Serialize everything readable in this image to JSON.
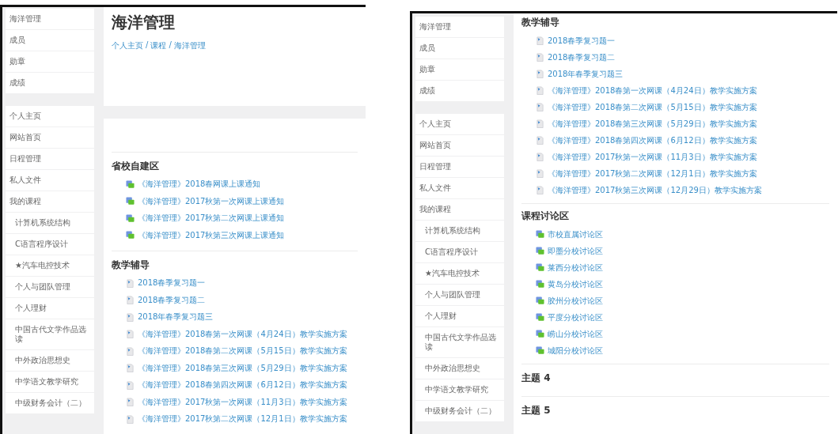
{
  "panels": [
    {
      "sidebar": {
        "groups": [
          [
            {
              "label": "海洋管理"
            },
            {
              "label": "成员"
            },
            {
              "label": "勋章"
            },
            {
              "label": "成绩"
            }
          ],
          [
            {
              "label": "个人主页"
            },
            {
              "label": "网站首页"
            },
            {
              "label": "日程管理"
            },
            {
              "label": "私人文件"
            },
            {
              "label": "我的课程",
              "children": [
                {
                  "label": "计算机系统结构"
                },
                {
                  "label": "C语言程序设计"
                },
                {
                  "label": "★汽车电控技术"
                },
                {
                  "label": "个人与团队管理"
                },
                {
                  "label": "个人理财"
                },
                {
                  "label": "中国古代文学作品选读"
                },
                {
                  "label": "中外政治思想史"
                },
                {
                  "label": "中学语文教学研究"
                },
                {
                  "label": "中级财务会计（二）"
                }
              ]
            }
          ]
        ]
      },
      "header": {
        "title": "海洋管理",
        "breadcrumb": [
          "个人主页",
          "课程",
          "海洋管理"
        ],
        "separator": "/"
      },
      "sections": [
        {
          "heading": "省校自建区",
          "items": [
            {
              "kind": "forum",
              "label": "《海洋管理》2018春网课上课通知"
            },
            {
              "kind": "forum",
              "label": "《海洋管理》2017秋第一次网课上课通知"
            },
            {
              "kind": "forum",
              "label": "《海洋管理》2017秋第二次网课上课通知"
            },
            {
              "kind": "forum",
              "label": "《海洋管理》2017秋第三次网课上课通知"
            }
          ]
        },
        {
          "heading": "教学辅导",
          "items": [
            {
              "kind": "file",
              "label": "2018春季复习题一"
            },
            {
              "kind": "file",
              "label": "2018春季复习题二"
            },
            {
              "kind": "file",
              "label": "2018年春季复习题三"
            },
            {
              "kind": "file",
              "label": "《海洋管理》2018春第一次网课（4月24日）教学实施方案"
            },
            {
              "kind": "file",
              "label": "《海洋管理》2018春第二次网课（5月15日）教学实施方案"
            },
            {
              "kind": "file",
              "label": "《海洋管理》2018春第三次网课（5月29日）教学实施方案"
            },
            {
              "kind": "file",
              "label": "《海洋管理》2018春第四次网课（6月12日）教学实施方案"
            },
            {
              "kind": "file",
              "label": "《海洋管理》2017秋第一次网课（11月3日）教学实施方案"
            },
            {
              "kind": "file",
              "label": "《海洋管理》2017秋第二次网课（12月1日）教学实施方案"
            }
          ]
        }
      ]
    },
    {
      "sidebar": {
        "groups": [
          [
            {
              "label": "海洋管理"
            },
            {
              "label": "成员"
            },
            {
              "label": "勋章"
            },
            {
              "label": "成绩"
            }
          ],
          [
            {
              "label": "个人主页"
            },
            {
              "label": "网站首页"
            },
            {
              "label": "日程管理"
            },
            {
              "label": "私人文件"
            },
            {
              "label": "我的课程",
              "children": [
                {
                  "label": "计算机系统结构"
                },
                {
                  "label": "C语言程序设计"
                },
                {
                  "label": "★汽车电控技术"
                },
                {
                  "label": "个人与团队管理"
                },
                {
                  "label": "个人理财"
                },
                {
                  "label": "中国古代文学作品选读"
                },
                {
                  "label": "中外政治思想史"
                },
                {
                  "label": "中学语文教学研究"
                },
                {
                  "label": "中级财务会计（二）"
                }
              ]
            }
          ]
        ]
      },
      "sections": [
        {
          "heading": "教学辅导",
          "items": [
            {
              "kind": "file",
              "label": "2018春季复习题一"
            },
            {
              "kind": "file",
              "label": "2018春季复习题二"
            },
            {
              "kind": "file",
              "label": "2018年春季复习题三"
            },
            {
              "kind": "file",
              "label": "《海洋管理》2018春第一次网课（4月24日）教学实施方案"
            },
            {
              "kind": "file",
              "label": "《海洋管理》2018春第二次网课（5月15日）教学实施方案"
            },
            {
              "kind": "file",
              "label": "《海洋管理》2018春第三次网课（5月29日）教学实施方案"
            },
            {
              "kind": "file",
              "label": "《海洋管理》2018春第四次网课（6月12日）教学实施方案"
            },
            {
              "kind": "file",
              "label": "《海洋管理》2017秋第一次网课（11月3日）教学实施方案"
            },
            {
              "kind": "file",
              "label": "《海洋管理》2017秋第二次网课（12月1日）教学实施方案"
            },
            {
              "kind": "file",
              "label": "《海洋管理》2017秋第三次网课（12月29日）教学实施方案"
            }
          ]
        },
        {
          "heading": "课程讨论区",
          "items": [
            {
              "kind": "forum",
              "label": "市校直属讨论区"
            },
            {
              "kind": "forum",
              "label": "即墨分校讨论区"
            },
            {
              "kind": "forum",
              "label": "莱西分校讨论区"
            },
            {
              "kind": "forum",
              "label": "黄岛分校讨论区"
            },
            {
              "kind": "forum",
              "label": "胶州分校讨论区"
            },
            {
              "kind": "forum",
              "label": "平度分校讨论区"
            },
            {
              "kind": "forum",
              "label": "崂山分校讨论区"
            },
            {
              "kind": "forum",
              "label": "城阳分校讨论区"
            }
          ]
        },
        {
          "heading": "主题 4"
        },
        {
          "heading": "主题 5"
        }
      ]
    }
  ]
}
